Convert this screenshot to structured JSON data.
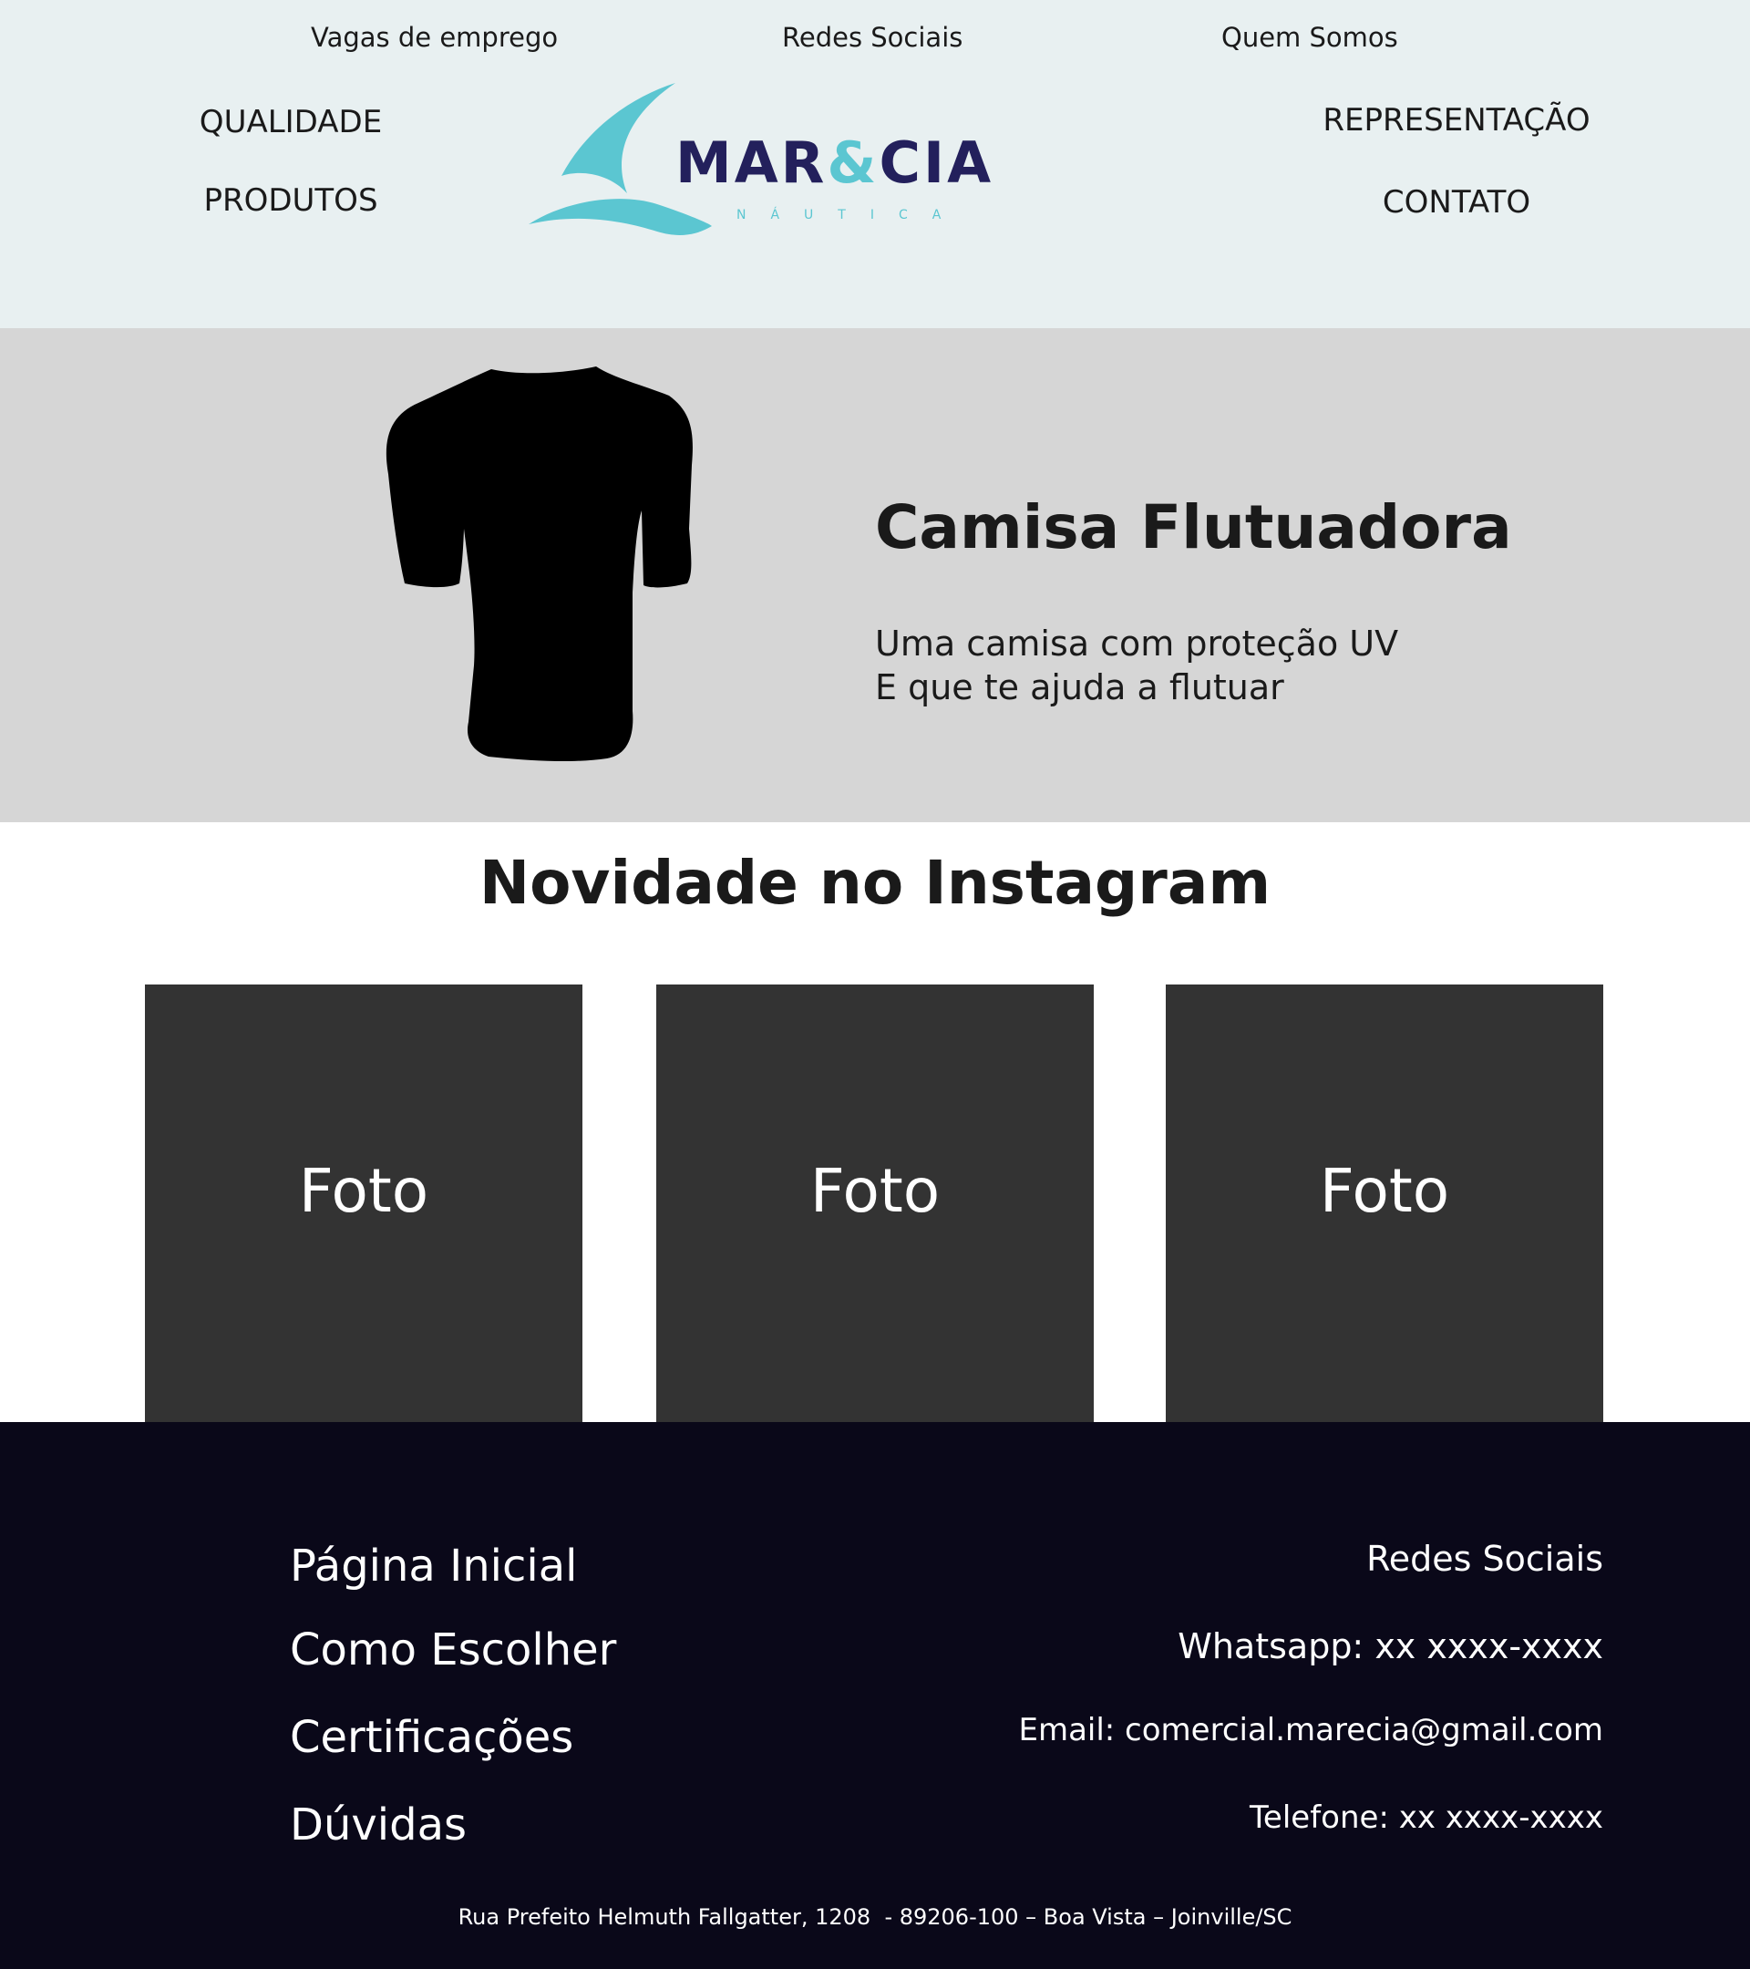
{
  "top_links": [
    "Vagas de emprego",
    "Redes Sociais",
    "Quem Somos"
  ],
  "nav": {
    "qualidade": "QUALIDADE",
    "produtos": "PRODUTOS",
    "representacao": "REPRESENTAÇÃO",
    "contato": "CONTATO"
  },
  "logo": {
    "word_left": "MAR",
    "word_amp": "&",
    "word_right": "CIA",
    "subtitle": "NÁUTICA"
  },
  "hero": {
    "title": "Camisa Flutuadora",
    "line1": "Uma camisa com proteção UV",
    "line2": "E que te ajuda a flutuar"
  },
  "instagram": {
    "title": "Novidade no Instagram",
    "photos": [
      "Foto",
      "Foto",
      "Foto"
    ]
  },
  "footer": {
    "links": [
      "Página Inicial",
      "Como Escolher",
      "Certificações",
      "Dúvidas"
    ],
    "social": "Redes Sociais",
    "whatsapp": "Whatsapp: xx xxxx-xxxx",
    "email": "Email: comercial.marecia@gmail.com",
    "phone": "Telefone: xx xxxx-xxxx",
    "address": "Rua Prefeito Helmuth Fallgatter, 1208  - 89206-100 – Boa Vista – Joinville/SC"
  },
  "colors": {
    "header_bg": "#e8f0f1",
    "hero_bg": "#d6d6d6",
    "photo_bg": "#333333",
    "footer_bg": "#0a0819",
    "brand_navy": "#23205c",
    "brand_teal": "#5bc6d1"
  }
}
